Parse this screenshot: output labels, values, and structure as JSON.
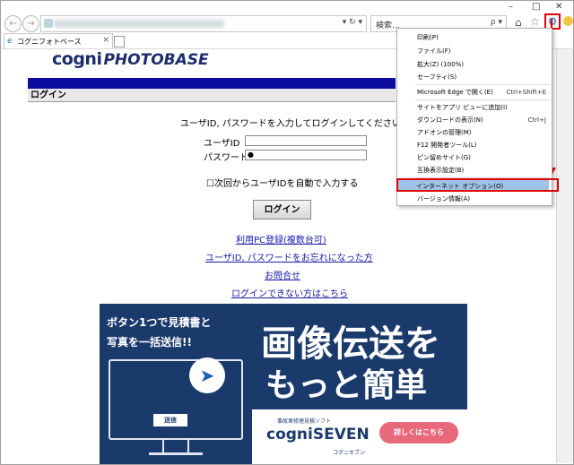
{
  "window": {
    "minimize": "–",
    "maximize": "□",
    "close": "✕"
  },
  "address": {
    "url_icons": "▾ ↻ ▾"
  },
  "search": {
    "placeholder": "検索...",
    "icons": "ρ ▾"
  },
  "tab": {
    "title": "コグニフォトベース",
    "close": "×"
  },
  "logo": {
    "part1": "cogni",
    "part2": "PHOTOBASE"
  },
  "page": {
    "login_header": "ログイン",
    "instruction": "ユーザID, パスワードを入力してログインしてください。",
    "userid_label": "ユーザID",
    "password_label": "パスワード",
    "password_value": "●",
    "remember_label": "☐次回からユーザIDを自動で入力する",
    "login_button": "ログイン",
    "links": [
      "利用PC登録(複数台可)",
      "ユーザID, パスワードをお忘れになった方",
      "お問合せ",
      "ログインできない方はこちら"
    ]
  },
  "banner": {
    "line1": "ボタン1つで見積書と",
    "line2": "写真を一括送信!!",
    "big1": "画像伝送を",
    "big2": "もっと簡単に!",
    "send": "送信",
    "tag": "事故車修理見積ソフト",
    "product": "cogniSEVEN",
    "product_sub": "コグニセブン",
    "detail": "詳しくはこちら"
  },
  "menu": {
    "items": [
      {
        "label": "印刷(P)",
        "shortcut": ""
      },
      {
        "label": "ファイル(F)",
        "shortcut": ""
      },
      {
        "label": "拡大(Z) (100%)",
        "shortcut": ""
      },
      {
        "label": "セーフティ(S)",
        "shortcut": ""
      },
      {
        "label": "Microsoft Edge で開く(E)",
        "shortcut": "Ctrl+Shift+E"
      },
      {
        "label": "サイトをアプリ ビューに追加(I)",
        "shortcut": ""
      },
      {
        "label": "ダウンロードの表示(N)",
        "shortcut": "Ctrl+J"
      },
      {
        "label": "アドオンの管理(M)",
        "shortcut": ""
      },
      {
        "label": "F12 開発者ツール(L)",
        "shortcut": ""
      },
      {
        "label": "ピン留めサイト(G)",
        "shortcut": ""
      },
      {
        "label": "互換表示設定(B)",
        "shortcut": ""
      },
      {
        "label": "インターネット オプション(O)",
        "shortcut": ""
      },
      {
        "label": "バージョン情報(A)",
        "shortcut": ""
      }
    ]
  }
}
